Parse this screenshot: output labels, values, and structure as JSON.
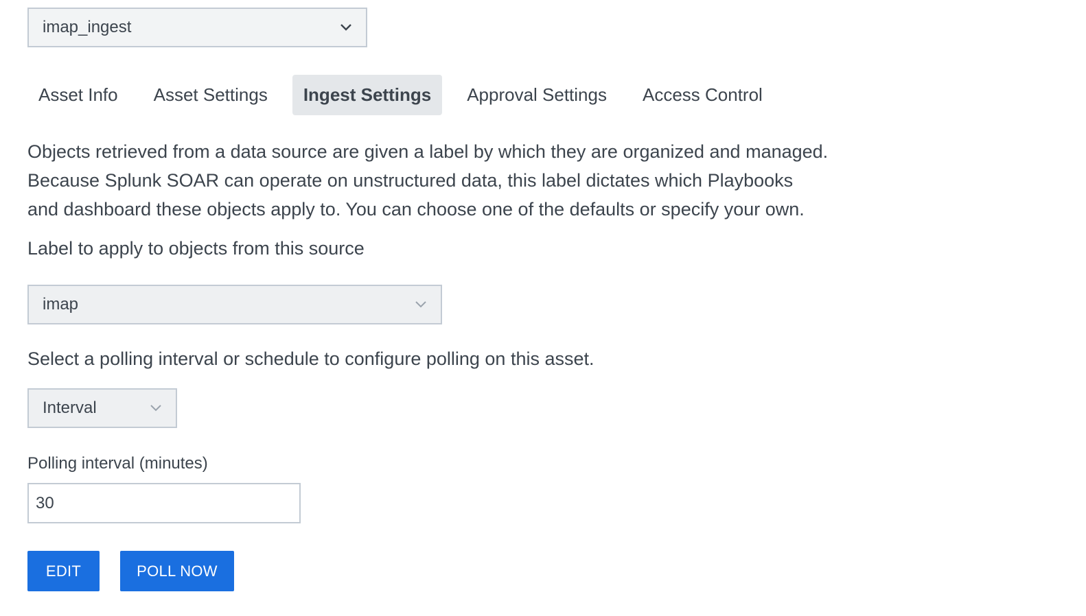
{
  "asset_selector": {
    "value": "imap_ingest",
    "icon": "chevron-down-icon"
  },
  "tabs": [
    {
      "label": "Asset Info",
      "active": false
    },
    {
      "label": "Asset Settings",
      "active": false
    },
    {
      "label": "Ingest Settings",
      "active": true
    },
    {
      "label": "Approval Settings",
      "active": false
    },
    {
      "label": "Access Control",
      "active": false
    }
  ],
  "description": {
    "lines": [
      "Objects retrieved from a data source are given a label by which they are organized and managed.",
      "Because Splunk SOAR can operate on unstructured data, this label dictates which Playbooks",
      "and dashboard these objects apply to. You can choose one of the defaults or specify your own."
    ]
  },
  "label_field": {
    "prompt": "Label to apply to objects from this source",
    "value": "imap"
  },
  "polling": {
    "prompt": "Select a polling interval or schedule to configure polling on this asset.",
    "mode": "Interval",
    "interval_label": "Polling interval (minutes)",
    "interval_value": "30"
  },
  "buttons": {
    "edit": "EDIT",
    "poll_now": "POLL NOW"
  },
  "colors": {
    "primary_button": "#1a6fe0",
    "active_tab_bg": "#e4e7ea",
    "text": "#3c444d"
  }
}
